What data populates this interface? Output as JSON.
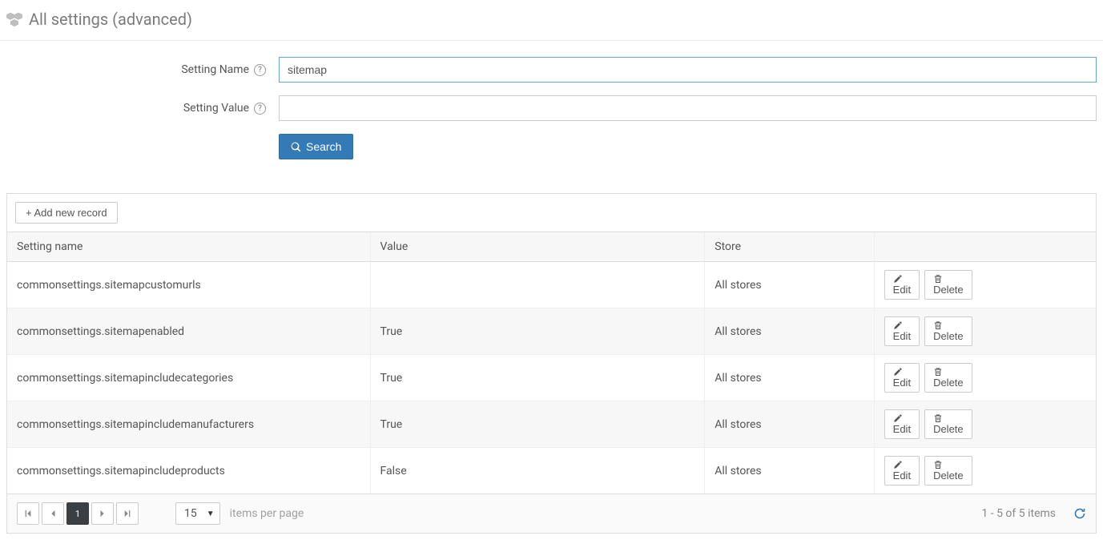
{
  "header": {
    "title": "All settings (advanced)"
  },
  "form": {
    "name_label": "Setting Name",
    "name_value": "sitemap",
    "value_label": "Setting Value",
    "value_value": "",
    "search_label": "Search"
  },
  "grid": {
    "add_label": "Add new record",
    "columns": {
      "name": "Setting name",
      "value": "Value",
      "store": "Store"
    },
    "edit_label": "Edit",
    "delete_label": "Delete",
    "rows": [
      {
        "name": "commonsettings.sitemapcustomurls",
        "value": "",
        "store": "All stores"
      },
      {
        "name": "commonsettings.sitemapenabled",
        "value": "True",
        "store": "All stores"
      },
      {
        "name": "commonsettings.sitemapincludecategories",
        "value": "True",
        "store": "All stores"
      },
      {
        "name": "commonsettings.sitemapincludemanufacturers",
        "value": "True",
        "store": "All stores"
      },
      {
        "name": "commonsettings.sitemapincludeproducts",
        "value": "False",
        "store": "All stores"
      }
    ]
  },
  "pager": {
    "current_page": "1",
    "page_size": "15",
    "items_per_page": "items per page",
    "info": "1 - 5 of 5 items"
  }
}
